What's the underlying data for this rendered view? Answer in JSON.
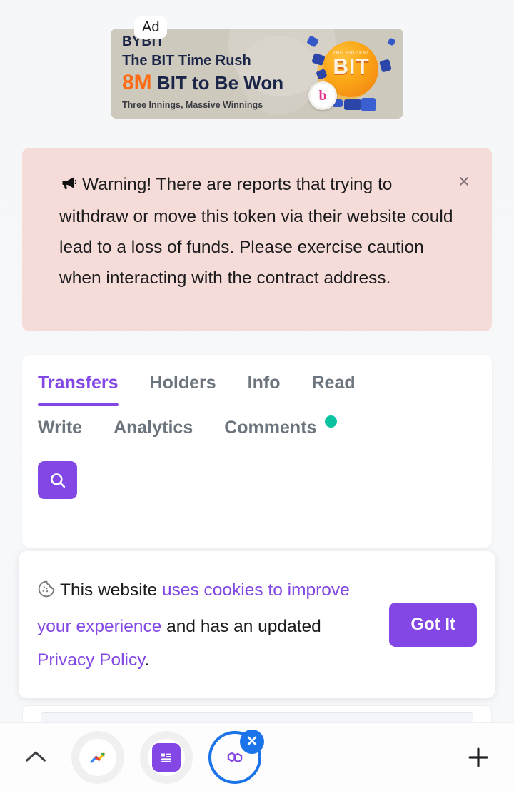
{
  "ad": {
    "badge_label": "Ad",
    "brand": "BYBIT",
    "headline": "The BIT Time Rush",
    "amount": "8M",
    "amount_suffix": "BIT to Be Won",
    "tagline": "Three Innings, Massive Winnings",
    "logo_top_text": "THE BIGGEST",
    "logo_word": "BIT",
    "coin_letter": "b",
    "background_color": "#cdc9bd",
    "accent_color": "#ff6a13"
  },
  "warning": {
    "icon": "megaphone-icon",
    "message": "Warning! There are reports that trying to withdraw or move this token via their website could lead to a loss of funds. Please exercise caution when interacting with the contract address.",
    "close_label": "×",
    "background_color": "#f6dcd8"
  },
  "tabs": {
    "row1": [
      {
        "label": "Transfers",
        "active": true
      },
      {
        "label": "Holders",
        "active": false
      },
      {
        "label": "Info",
        "active": false
      },
      {
        "label": "Read",
        "active": false
      }
    ],
    "row2": [
      {
        "label": "Write",
        "active": false
      },
      {
        "label": "Analytics",
        "active": false
      },
      {
        "label": "Comments",
        "active": false,
        "dot": true
      }
    ],
    "active_color": "#8247e5",
    "inactive_color": "#6c757d",
    "dot_color": "#09c3a0"
  },
  "search": {
    "icon": "search-icon",
    "button_color": "#8247e5"
  },
  "cookie": {
    "icon": "cookie-icon",
    "text_part1": "This website ",
    "link1": "uses cookies to improve your experience",
    "text_part2": " and has an updated ",
    "link2": "Privacy Policy",
    "text_part3": ".",
    "button_label": "Got It",
    "button_color": "#8247e5",
    "link_color": "#8247e5"
  },
  "bottom_bar": {
    "chevron_icon": "chevron-up-icon",
    "plus_icon": "plus-icon",
    "tabs": [
      {
        "icon": "google-analytics-icon",
        "active": false
      },
      {
        "icon": "document-list-icon",
        "active": false
      },
      {
        "icon": "polygon-icon",
        "active": true,
        "close_label": "✕"
      }
    ],
    "active_outline_color": "#1a73e8"
  }
}
